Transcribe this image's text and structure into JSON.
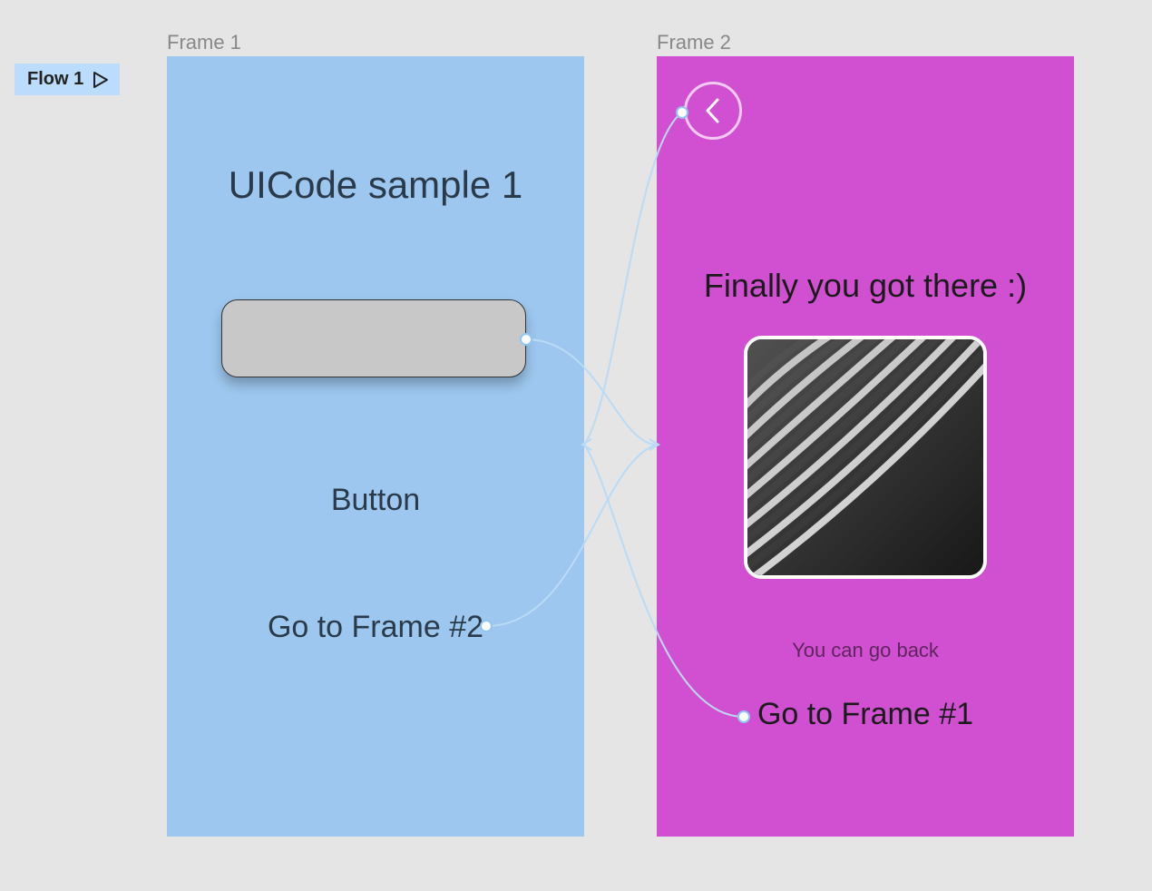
{
  "flowBadge": {
    "label": "Flow 1"
  },
  "frames": {
    "f1": {
      "label": "Frame 1",
      "title": "UICode sample 1",
      "buttonLabel": "Button",
      "goto": "Go to Frame #2"
    },
    "f2": {
      "label": "Frame 2",
      "title": "Finally you got there :)",
      "caption": "You can go back",
      "goto": "Go to Frame #1"
    }
  }
}
